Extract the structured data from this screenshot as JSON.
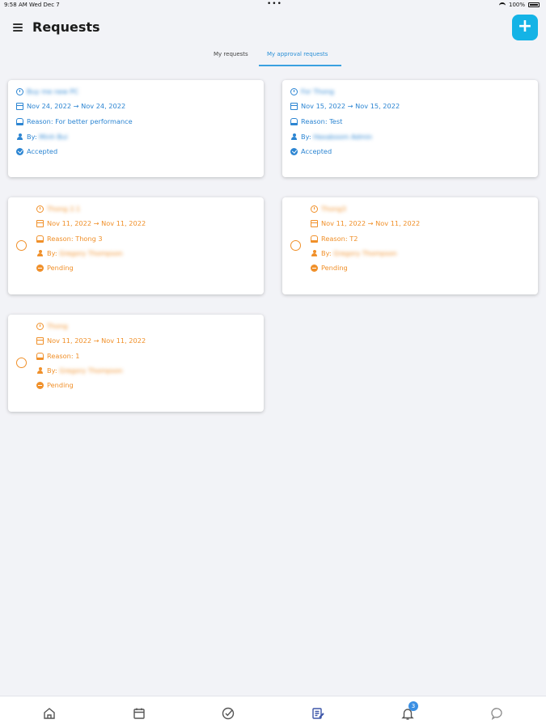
{
  "status_bar": {
    "time": "9:58 AM",
    "date": "Wed Dec 7",
    "battery": "100%"
  },
  "header": {
    "title": "Requests",
    "add_label": "+"
  },
  "tabs": [
    {
      "label": "My requests",
      "active": false
    },
    {
      "label": "My approval requests",
      "active": true
    }
  ],
  "colors": {
    "accent": "#14b3e6",
    "accepted": "#2c85d2",
    "pending": "#f0902a"
  },
  "cards": [
    {
      "title": "Buy me new PC",
      "dates": "Nov 24, 2022 → Nov 24, 2022",
      "reason": "Reason: For better performance",
      "by_label": "By:",
      "by": "Minh Bui",
      "status": "Accepted"
    },
    {
      "title": "For Thong",
      "dates": "Nov 15, 2022 → Nov 15, 2022",
      "reason": "Reason: Test",
      "by_label": "By:",
      "by": "Hexaboom Admin",
      "status": "Accepted"
    },
    {
      "title": "Thong 2.1",
      "dates": "Nov 11, 2022 → Nov 11, 2022",
      "reason": "Reason: Thong 3",
      "by_label": "By:",
      "by": "Gregory Thompson",
      "status": "Pending"
    },
    {
      "title": "Thong3",
      "dates": "Nov 11, 2022 → Nov 11, 2022",
      "reason": "Reason: T2",
      "by_label": "By:",
      "by": "Gregory Thompson",
      "status": "Pending"
    },
    {
      "title": "Thong",
      "dates": "Nov 11, 2022 → Nov 11, 2022",
      "reason": "Reason: 1",
      "by_label": "By:",
      "by": "Gregory Thompson",
      "status": "Pending"
    }
  ],
  "bottom_nav": {
    "items": [
      "home-icon",
      "calendar-icon",
      "check-circle-icon",
      "requests-icon",
      "bell-icon",
      "chat-icon"
    ],
    "notification_count": "3"
  }
}
